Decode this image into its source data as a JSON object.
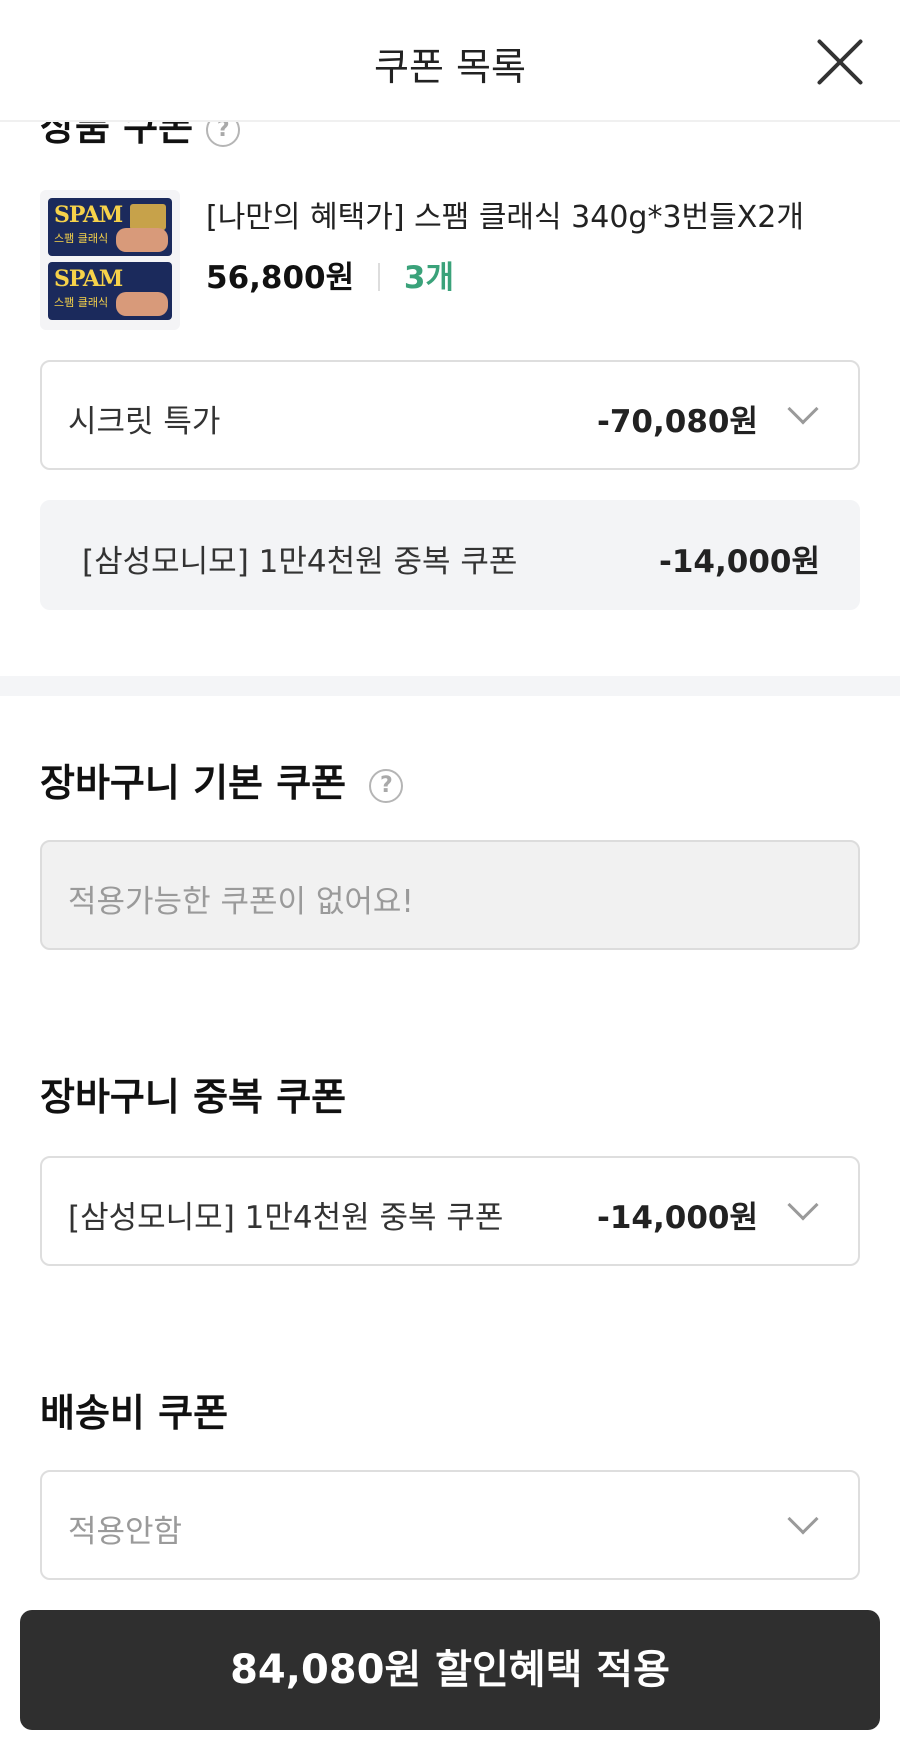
{
  "header": {
    "title": "쿠폰 목록"
  },
  "product_coupon": {
    "title": "상품 쿠폰",
    "help_icon": "question-circle-icon",
    "product": {
      "thumb_brand": "SPAM",
      "thumb_sub": "스팸 클래식",
      "name": "[나만의 혜택가] 스팸 클래식 340g*3번들X2개",
      "price": "56,800원",
      "quantity": "3개"
    },
    "selected_coupon": {
      "label": "시크릿 특가",
      "amount": "-70,080원"
    },
    "stacked_coupon": {
      "label": "[삼성모니모] 1만4천원 중복 쿠폰",
      "amount": "-14,000원"
    }
  },
  "cart_basic": {
    "title": "장바구니 기본 쿠폰",
    "help_icon": "question-circle-icon",
    "empty_text": "적용가능한 쿠폰이 없어요!"
  },
  "cart_stack": {
    "title": "장바구니 중복 쿠폰",
    "selected": {
      "label": "[삼성모니모] 1만4천원 중복 쿠폰",
      "amount": "-14,000원"
    }
  },
  "shipping": {
    "title": "배송비 쿠폰",
    "selected": {
      "label": "적용안함"
    }
  },
  "apply_button": {
    "label": "84,080원 할인혜택 적용"
  },
  "colors": {
    "quantity": "#3aa27a",
    "button_bg": "#2f2f2f",
    "box_border": "#dedede",
    "grey_box": "#f3f4f6"
  }
}
